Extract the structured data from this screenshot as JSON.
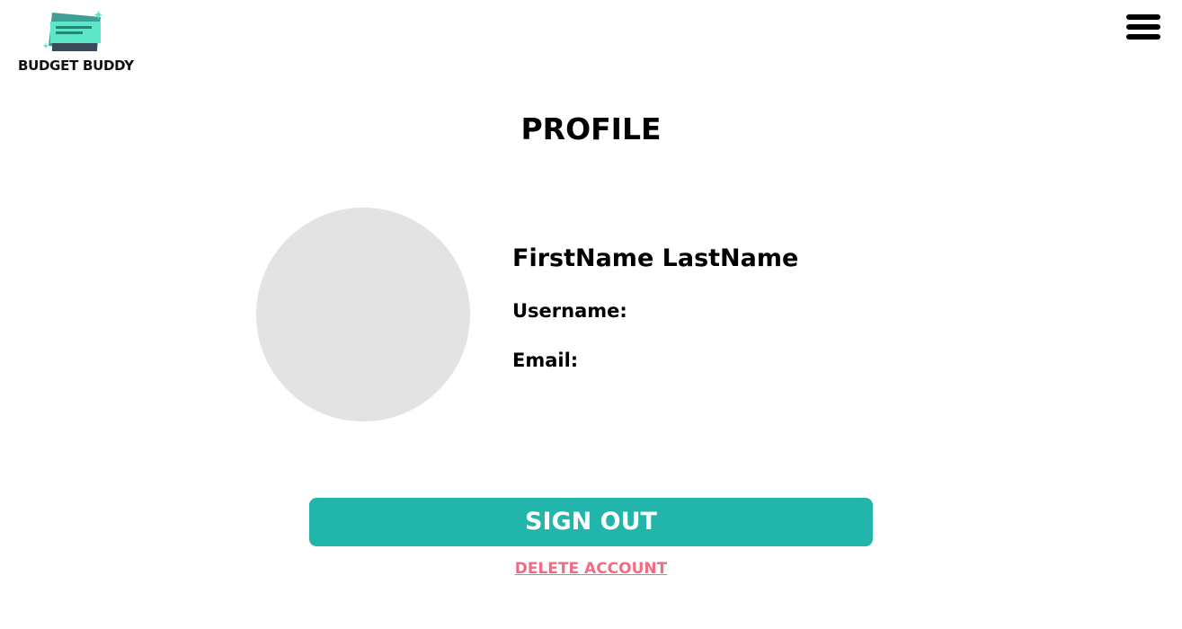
{
  "header": {
    "logo_text": "BUDGET BUDDY",
    "logo_icon": "money-bills-icon",
    "menu_icon": "hamburger-menu-icon"
  },
  "main": {
    "title": "PROFILE",
    "full_name": "FirstName LastName",
    "username_label": "Username:",
    "username_value": "",
    "email_label": "Email:",
    "email_value": ""
  },
  "actions": {
    "sign_out_label": "SIGN OUT",
    "delete_account_label": "DELETE ACCOUNT"
  },
  "colors": {
    "accent": "#22b5ab",
    "danger_link": "#f06c84",
    "avatar_placeholder": "#e3e3e3",
    "logo_front": "#5ee6c8",
    "logo_back": "#3f9e96",
    "logo_dark": "#3b4a5a"
  }
}
